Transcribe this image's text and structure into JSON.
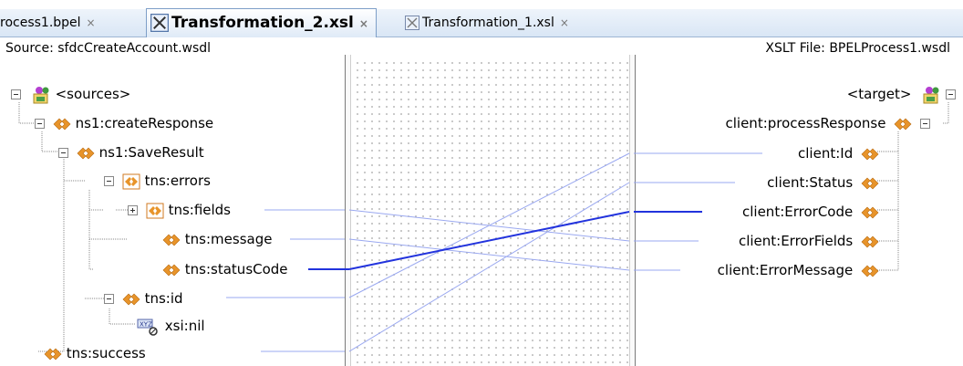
{
  "tabs": [
    {
      "label": "rocess1.bpel",
      "close": "×",
      "active": false
    },
    {
      "label": "Transformation_2.xsl",
      "close": "×",
      "active": true,
      "icon": "xslt-map-icon"
    },
    {
      "label": "Transformation_1.xsl",
      "close": "×",
      "active": false,
      "icon": "xslt-map-icon"
    }
  ],
  "source": {
    "header": "Source: sfdcCreateAccount.wsdl",
    "nodes": [
      {
        "label": "<sources>",
        "icon": "sources-icon"
      },
      {
        "label": "ns1:createResponse",
        "icon": "element-icon"
      },
      {
        "label": "ns1:SaveResult",
        "icon": "element-icon"
      },
      {
        "label": "tns:errors",
        "icon": "repeating-element-icon"
      },
      {
        "label": "tns:fields",
        "icon": "repeating-element-icon"
      },
      {
        "label": "tns:message",
        "icon": "element-icon"
      },
      {
        "label": "tns:statusCode",
        "icon": "element-icon"
      },
      {
        "label": "tns:id",
        "icon": "element-icon"
      },
      {
        "label": "xsi:nil",
        "icon": "attribute-icon"
      },
      {
        "label": "tns:success",
        "icon": "element-icon"
      }
    ]
  },
  "target": {
    "header": "XSLT File: BPELProcess1.wsdl",
    "nodes": [
      {
        "label": "<target>",
        "icon": "target-icon"
      },
      {
        "label": "client:processResponse",
        "icon": "element-icon"
      },
      {
        "label": "client:Id",
        "icon": "element-icon"
      },
      {
        "label": "client:Status",
        "icon": "element-icon"
      },
      {
        "label": "client:ErrorCode",
        "icon": "element-icon"
      },
      {
        "label": "client:ErrorFields",
        "icon": "element-icon"
      },
      {
        "label": "client:ErrorMessage",
        "icon": "element-icon"
      }
    ]
  },
  "colors": {
    "map_line": "#9aa8f0",
    "selected_line": "#2233dd",
    "element_icon": "#e8942a"
  }
}
